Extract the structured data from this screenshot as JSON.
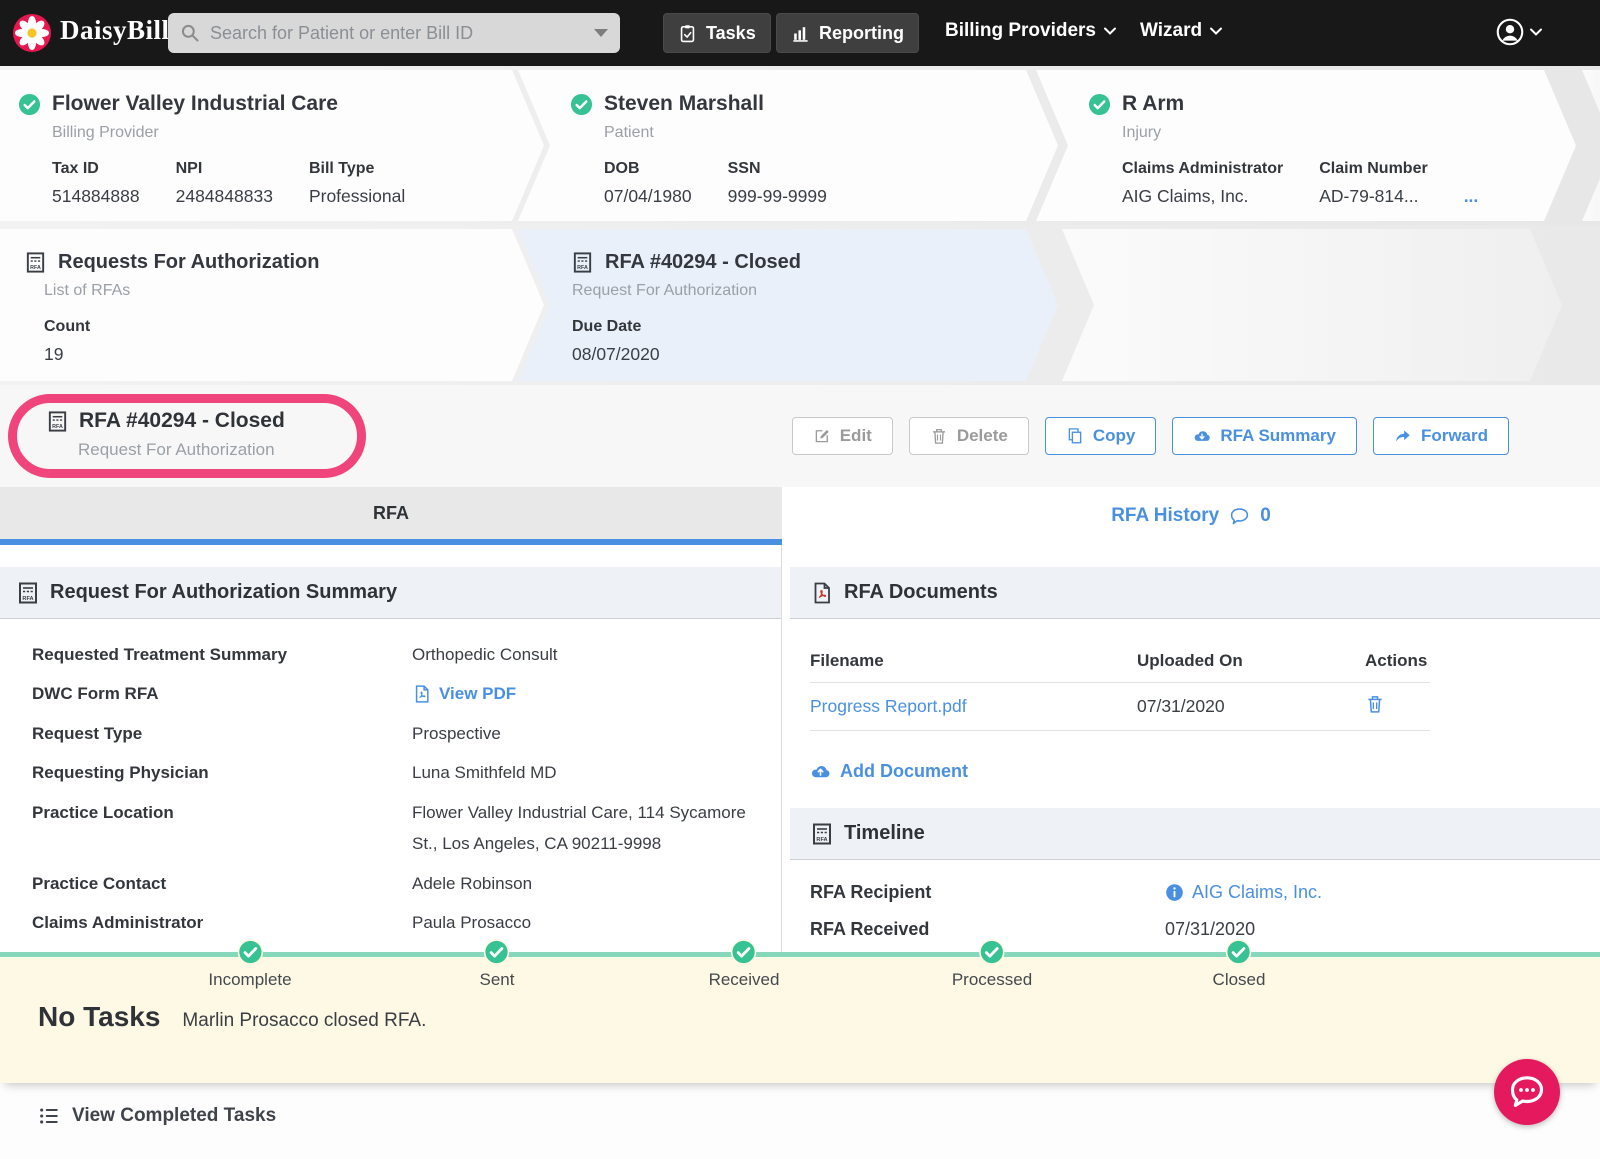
{
  "colors": {
    "accent_blue": "#4a90e2",
    "success_green": "#36c293",
    "annotation_pink": "#f0447c",
    "chat_pink": "#e5195e",
    "progress_teal": "#87d8bb",
    "banner_yellow": "#fdf9e4"
  },
  "nav": {
    "brand": "DaisyBill",
    "search_placeholder": "Search for Patient or enter Bill ID",
    "tasks": "Tasks",
    "reporting": "Reporting",
    "billing_providers": "Billing Providers",
    "wizard": "Wizard"
  },
  "crumbs1": [
    {
      "title": "Flower Valley Industrial Care",
      "subtitle": "Billing Provider",
      "fields": [
        {
          "label": "Tax ID",
          "value": "514884888"
        },
        {
          "label": "NPI",
          "value": "2484848833"
        },
        {
          "label": "Bill Type",
          "value": "Professional"
        }
      ]
    },
    {
      "title": "Steven Marshall",
      "subtitle": "Patient",
      "fields": [
        {
          "label": "DOB",
          "value": "07/04/1980"
        },
        {
          "label": "SSN",
          "value": "999-99-9999"
        }
      ]
    },
    {
      "title": "R Arm",
      "subtitle": "Injury",
      "fields": [
        {
          "label": "Claims Administrator",
          "value": "AIG Claims, Inc."
        },
        {
          "label": "Claim Number",
          "value": "AD-79-814..."
        }
      ],
      "more": "..."
    }
  ],
  "crumbs2": [
    {
      "title": "Requests For Authorization",
      "subtitle": "List of RFAs",
      "fields": [
        {
          "label": "Count",
          "value": "19"
        }
      ]
    },
    {
      "title": "RFA #40294 - Closed",
      "subtitle": "Request For Authorization",
      "fields": [
        {
          "label": "Due Date",
          "value": "08/07/2020"
        }
      ]
    }
  ],
  "action_bar": {
    "title": "RFA #40294 - Closed",
    "subtitle": "Request For Authorization",
    "edit": "Edit",
    "delete": "Delete",
    "copy": "Copy",
    "rfa_summary": "RFA Summary",
    "forward": "Forward"
  },
  "tabs": {
    "rfa": "RFA",
    "history": "RFA History",
    "history_count": "0"
  },
  "summary": {
    "heading": "Request For Authorization Summary",
    "rows": [
      {
        "label": "Requested Treatment Summary",
        "value": "Orthopedic Consult"
      },
      {
        "label": "DWC Form RFA",
        "value": "View PDF"
      },
      {
        "label": "Request Type",
        "value": "Prospective"
      },
      {
        "label": "Requesting Physician",
        "value": "Luna Smithfeld MD"
      },
      {
        "label": "Practice Location",
        "value": "Flower Valley Industrial Care, 114 Sycamore St., Los Angeles, CA 90211-9998"
      },
      {
        "label": "Practice Contact",
        "value": "Adele Robinson"
      },
      {
        "label": "Claims Administrator",
        "value": "Paula Prosacco"
      }
    ]
  },
  "documents": {
    "heading": "RFA Documents",
    "columns": [
      "Filename",
      "Uploaded On",
      "Actions"
    ],
    "rows": [
      {
        "filename": "Progress Report.pdf",
        "uploaded": "07/31/2020"
      }
    ],
    "add_label": "Add Document"
  },
  "timeline": {
    "heading": "Timeline",
    "rows": [
      {
        "label": "RFA Recipient",
        "value": "AIG Claims, Inc."
      },
      {
        "label": "RFA Received",
        "value": "07/31/2020"
      }
    ]
  },
  "progress": {
    "steps": [
      "Incomplete",
      "Sent",
      "Received",
      "Processed",
      "Closed"
    ]
  },
  "tasks_banner": {
    "title": "No Tasks",
    "message": "Marlin Prosacco closed RFA."
  },
  "footer": {
    "view_completed": "View Completed Tasks"
  }
}
